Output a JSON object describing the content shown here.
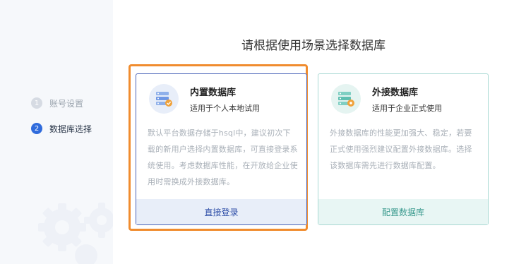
{
  "title": "请根据使用场景选择数据库",
  "steps": [
    {
      "num": "1",
      "label": "账号设置",
      "state": "inactive"
    },
    {
      "num": "2",
      "label": "数据库选择",
      "state": "active"
    }
  ],
  "cards": [
    {
      "title": "内置数据库",
      "subtitle": "适用于个人本地试用",
      "description": "默认平台数据存储于hsql中，建议初次下载的新用户选择内置数据库，可直接登录系统使用。考虑数据库性能，在开放给企业使用时需换成外接数据库。",
      "button": "直接登录",
      "icon": "database-server-icon",
      "accent": "#4a63b8"
    },
    {
      "title": "外接数据库",
      "subtitle": "适用于企业正式使用",
      "description": "外接数据库的性能更加强大、稳定，若要正式使用强烈建议配置外接数据库。选择该数据库需先进行数据库配置。",
      "button": "配置数据库",
      "icon": "database-config-icon",
      "accent": "#3a9a8e"
    }
  ],
  "colors": {
    "highlight": "#f08c2e",
    "active_step": "#2f6bdc"
  }
}
